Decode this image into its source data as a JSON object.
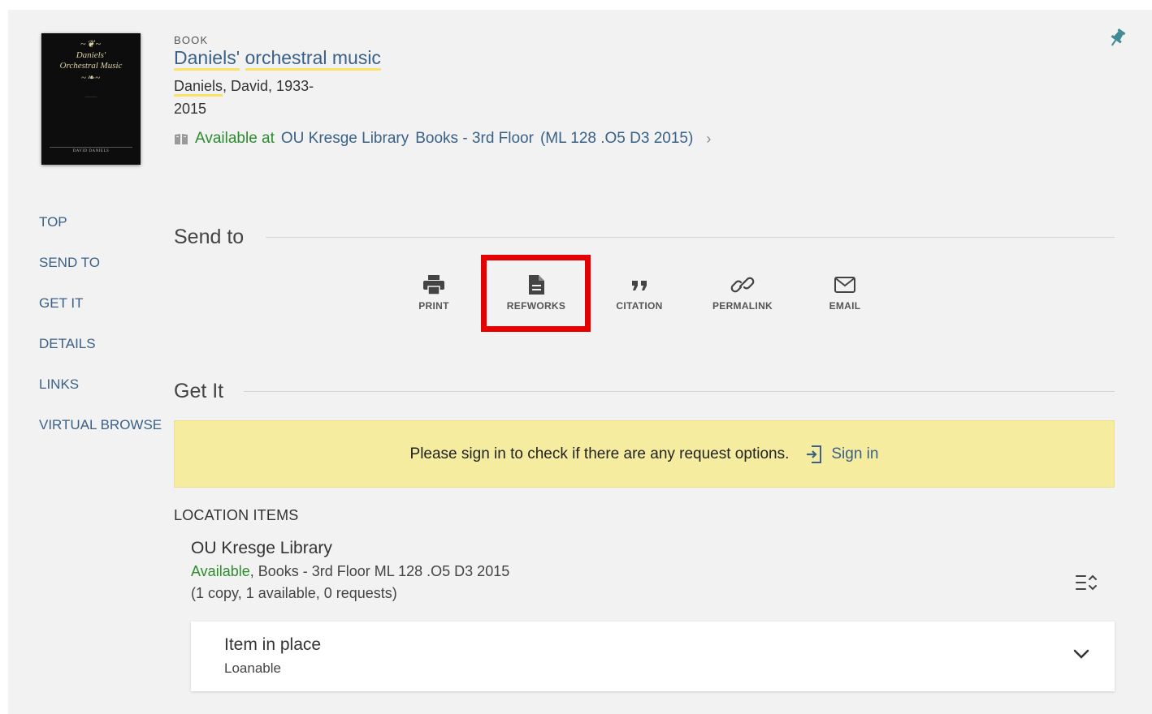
{
  "record": {
    "type": "BOOK",
    "title_part1": "Daniels'",
    "title_part2": "orchestral music",
    "creator_name": "Daniels",
    "creator_rest": ", David, 1933-",
    "date": "2015",
    "availability_status": "Available at",
    "availability_library": "OU Kresge Library",
    "availability_location": "Books - 3rd Floor",
    "availability_call_number": "(ML 128 .O5 D3 2015)",
    "cover": {
      "title_line1": "Daniels'",
      "title_line2": "Orchestral Music",
      "author": "DAVID DANIELS"
    }
  },
  "leftnav": {
    "items": [
      "TOP",
      "SEND TO",
      "GET IT",
      "DETAILS",
      "LINKS",
      "VIRTUAL BROWSE"
    ]
  },
  "send_to": {
    "title": "Send to",
    "actions": [
      {
        "label": "PRINT",
        "icon": "print-icon"
      },
      {
        "label": "REFWORKS",
        "icon": "document-icon"
      },
      {
        "label": "CITATION",
        "icon": "quote-icon"
      },
      {
        "label": "PERMALINK",
        "icon": "link-icon"
      },
      {
        "label": "EMAIL",
        "icon": "mail-icon"
      }
    ]
  },
  "get_it": {
    "title": "Get It",
    "signin_message": "Please sign in to check if there are any request options.",
    "signin_label": "Sign in",
    "location_items_label": "LOCATION ITEMS",
    "location": {
      "name": "OU Kresge Library",
      "status": "Available",
      "detail": ", Books - 3rd Floor ML 128 .O5 D3 2015",
      "copies": "(1 copy, 1 available, 0 requests)"
    },
    "item": {
      "status": "Item in place",
      "policy": "Loanable"
    }
  },
  "colors": {
    "link": "#3a6188",
    "available": "#2e8b2e",
    "highlight_underline": "#f8e26b",
    "signin_bar": "#f5ec9f",
    "annotation_box": "#e60000",
    "pin": "#3f8a93"
  }
}
